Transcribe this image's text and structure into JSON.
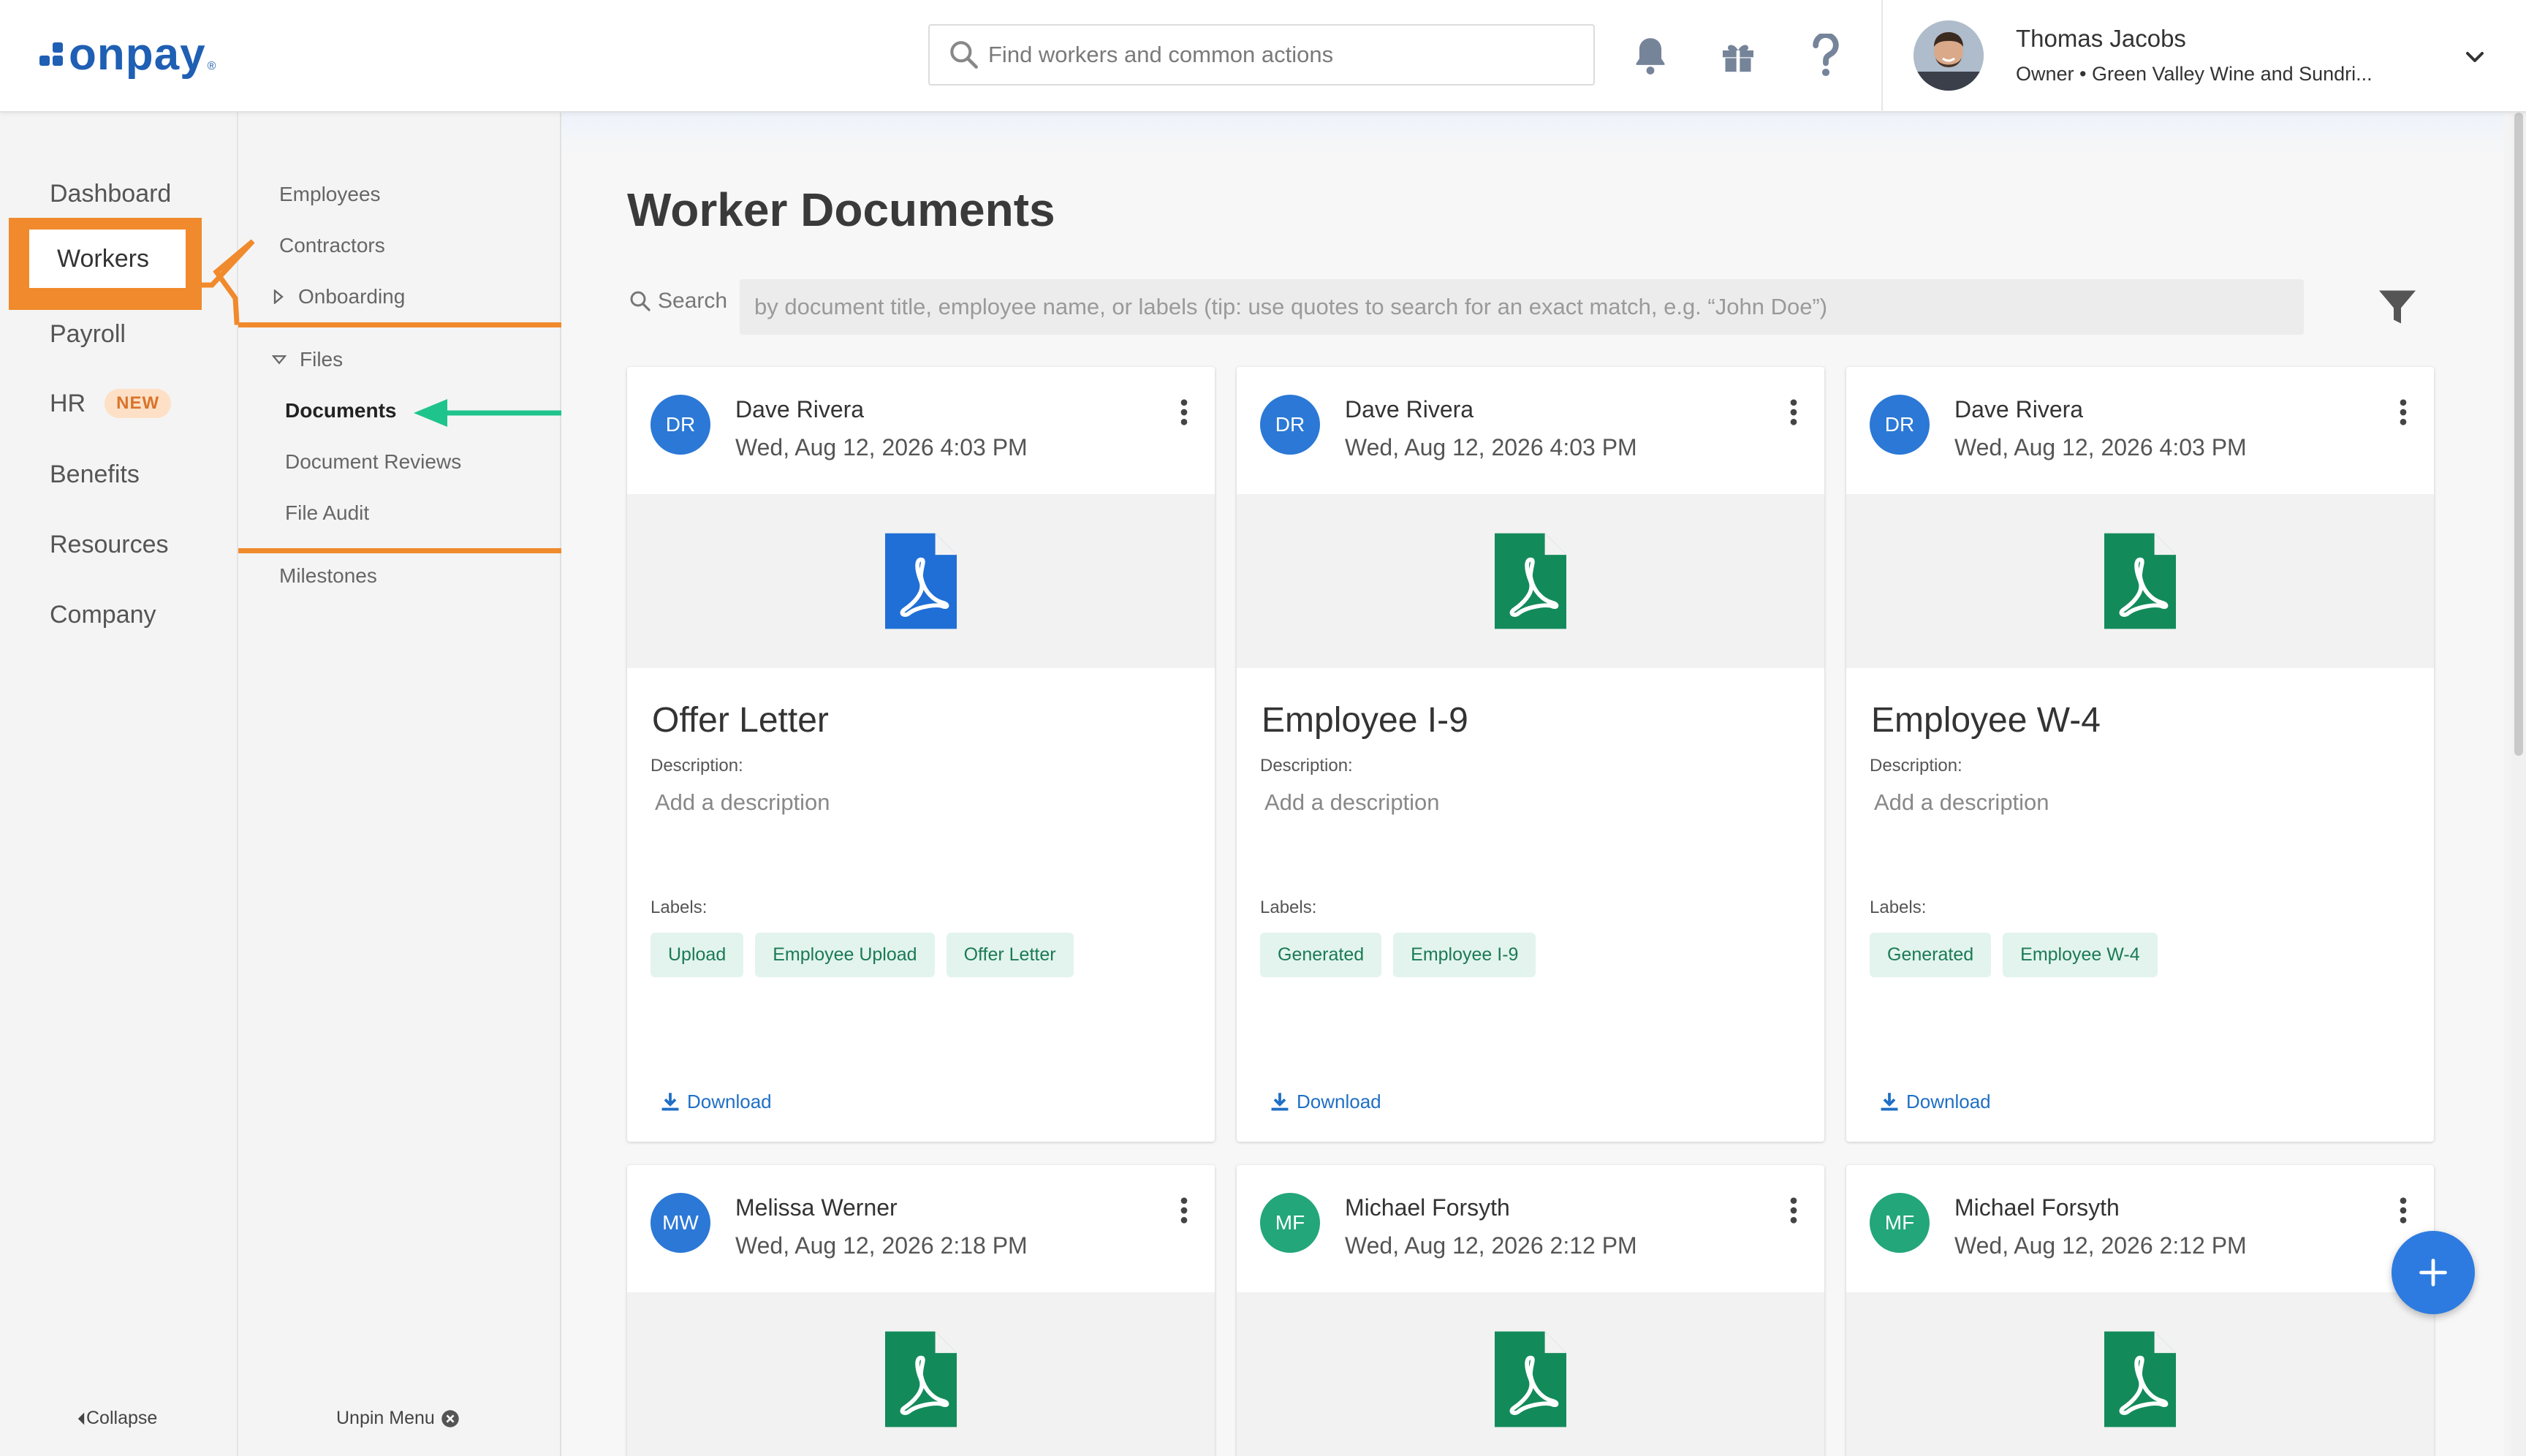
{
  "brand": {
    "name": "onpay",
    "accent": "#1f5fb4"
  },
  "header": {
    "search_placeholder": "Find workers and common actions",
    "icons": [
      "bell-icon",
      "gift-icon",
      "help-icon"
    ],
    "user": {
      "name": "Thomas Jacobs",
      "role": "Owner • Green Valley Wine and Sundri..."
    }
  },
  "leftnav": {
    "items": [
      "Dashboard",
      "Workers",
      "Payroll",
      "HR",
      "Benefits",
      "Resources",
      "Company"
    ],
    "active": "Workers",
    "hr_badge": "NEW",
    "collapse_label": "Collapse"
  },
  "subnav": {
    "employees": "Employees",
    "contractors": "Contractors",
    "onboarding": "Onboarding",
    "files": "Files",
    "documents": "Documents",
    "document_reviews": "Document Reviews",
    "file_audit": "File Audit",
    "milestones": "Milestones",
    "unpin_label": "Unpin Menu"
  },
  "main": {
    "title": "Worker Documents",
    "search_label": "Search",
    "search_placeholder": "by document title, employee name, or labels (tip: use quotes to search for an exact match, e.g. “John Doe”)"
  },
  "cards": [
    {
      "initials": "DR",
      "name": "Dave Rivera",
      "date": "Wed, Aug 12, 2026 4:03 PM",
      "title": "Offer Letter",
      "description_label": "Description:",
      "description": "Add a description",
      "labels_label": "Labels:",
      "labels": [
        "Upload",
        "Employee Upload",
        "Offer Letter"
      ],
      "download": "Download",
      "icon_color": "#1f6fd6",
      "avatar_color": "#2b78d6"
    },
    {
      "initials": "DR",
      "name": "Dave Rivera",
      "date": "Wed, Aug 12, 2026 4:03 PM",
      "title": "Employee I-9",
      "description_label": "Description:",
      "description": "Add a description",
      "labels_label": "Labels:",
      "labels": [
        "Generated",
        "Employee I-9"
      ],
      "download": "Download",
      "icon_color": "#138a5a",
      "avatar_color": "#2b78d6"
    },
    {
      "initials": "DR",
      "name": "Dave Rivera",
      "date": "Wed, Aug 12, 2026 4:03 PM",
      "title": "Employee W-4",
      "description_label": "Description:",
      "description": "Add a description",
      "labels_label": "Labels:",
      "labels": [
        "Generated",
        "Employee W-4"
      ],
      "download": "Download",
      "icon_color": "#138a5a",
      "avatar_color": "#2b78d6"
    },
    {
      "initials": "MW",
      "name": "Melissa Werner",
      "date": "Wed, Aug 12, 2026 2:18 PM",
      "icon_color": "#138a5a",
      "avatar_color": "#2b78d6"
    },
    {
      "initials": "MF",
      "name": "Michael Forsyth",
      "date": "Wed, Aug 12, 2026 2:12 PM",
      "icon_color": "#138a5a",
      "avatar_color": "#22a67a"
    },
    {
      "initials": "MF",
      "name": "Michael Forsyth",
      "date": "Wed, Aug 12, 2026 2:12 PM",
      "icon_color": "#138a5a",
      "avatar_color": "#22a67a"
    }
  ],
  "annotation_colors": {
    "highlight": "#f08a2c",
    "arrow": "#1ec48c"
  }
}
